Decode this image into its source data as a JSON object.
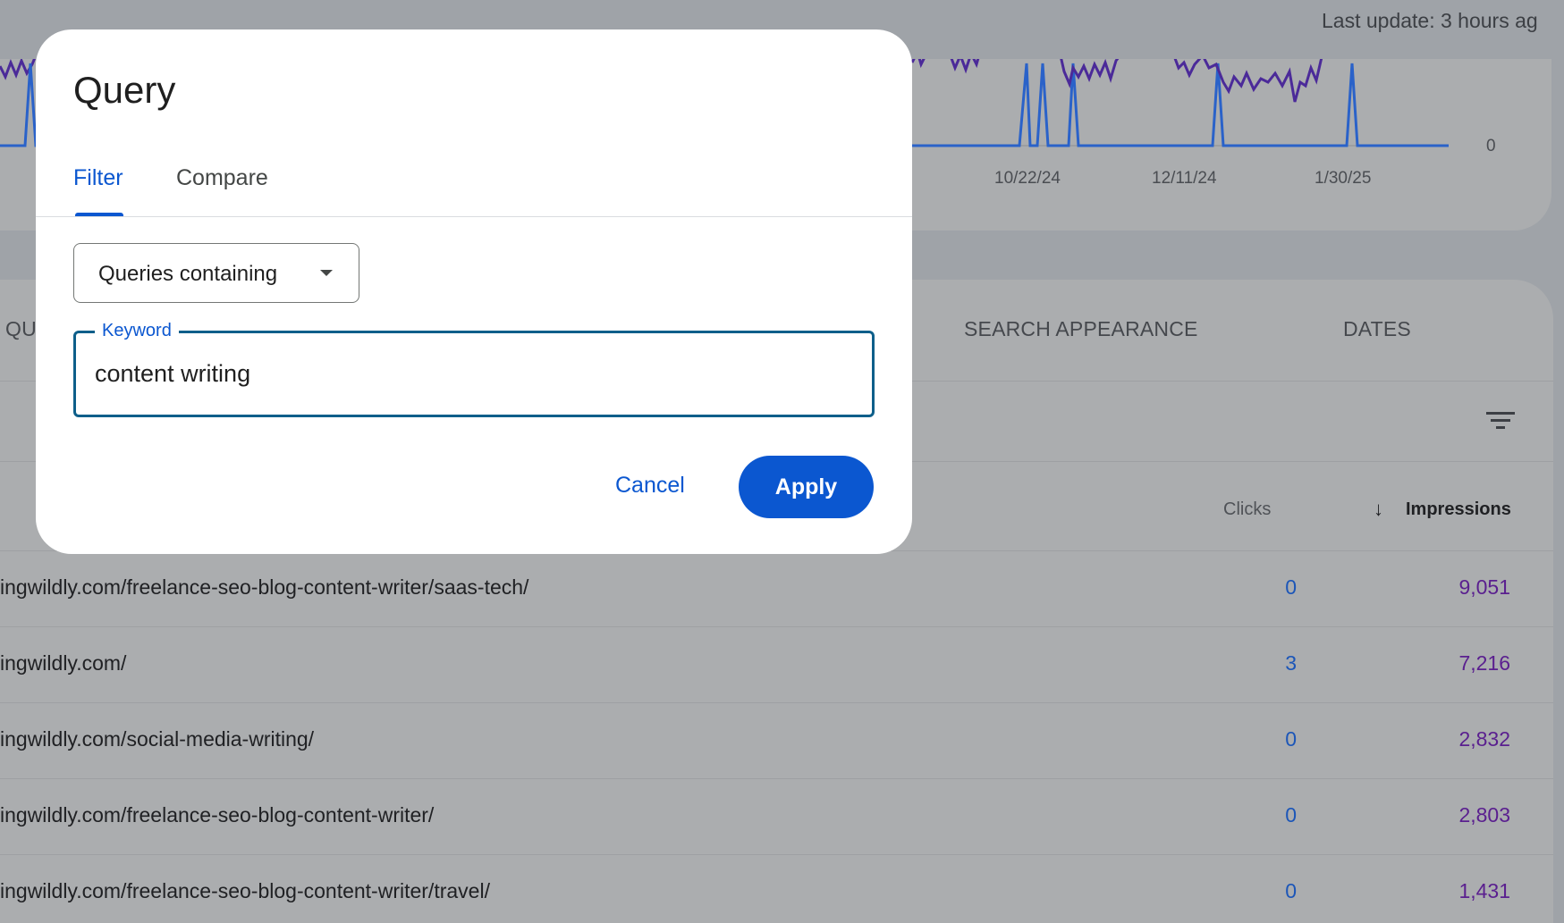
{
  "header": {
    "last_update": "Last update: 3 hours ag"
  },
  "chart": {
    "x_ticks": [
      "10/22/24",
      "12/11/24",
      "1/30/25"
    ],
    "y_zero_label": "0",
    "colors": {
      "clicks": "#2a62c9",
      "impressions": "#4b2a99"
    }
  },
  "table": {
    "tabs": [
      "QU",
      "SEARCH APPEARANCE",
      "DATES"
    ],
    "columns": {
      "clicks": "Clicks",
      "impressions": "Impressions"
    },
    "sort_icon": "arrow-down-icon",
    "rows": [
      {
        "url": "ingwildly.com/freelance-seo-blog-content-writer/saas-tech/",
        "clicks": "0",
        "impressions": "9,051"
      },
      {
        "url": "ingwildly.com/",
        "clicks": "3",
        "impressions": "7,216"
      },
      {
        "url": "ingwildly.com/social-media-writing/",
        "clicks": "0",
        "impressions": "2,832"
      },
      {
        "url": "ingwildly.com/freelance-seo-blog-content-writer/",
        "clicks": "0",
        "impressions": "2,803"
      },
      {
        "url": "ingwildly.com/freelance-seo-blog-content-writer/travel/",
        "clicks": "0",
        "impressions": "1,431"
      }
    ]
  },
  "dialog": {
    "title": "Query",
    "tabs": {
      "filter": "Filter",
      "compare": "Compare"
    },
    "active_tab": "Filter",
    "select": {
      "value": "Queries containing",
      "icon": "dropdown-triangle-icon"
    },
    "keyword": {
      "label": "Keyword",
      "value": "content writing"
    },
    "buttons": {
      "cancel": "Cancel",
      "apply": "Apply"
    },
    "accent_color": "#0b57d0"
  }
}
